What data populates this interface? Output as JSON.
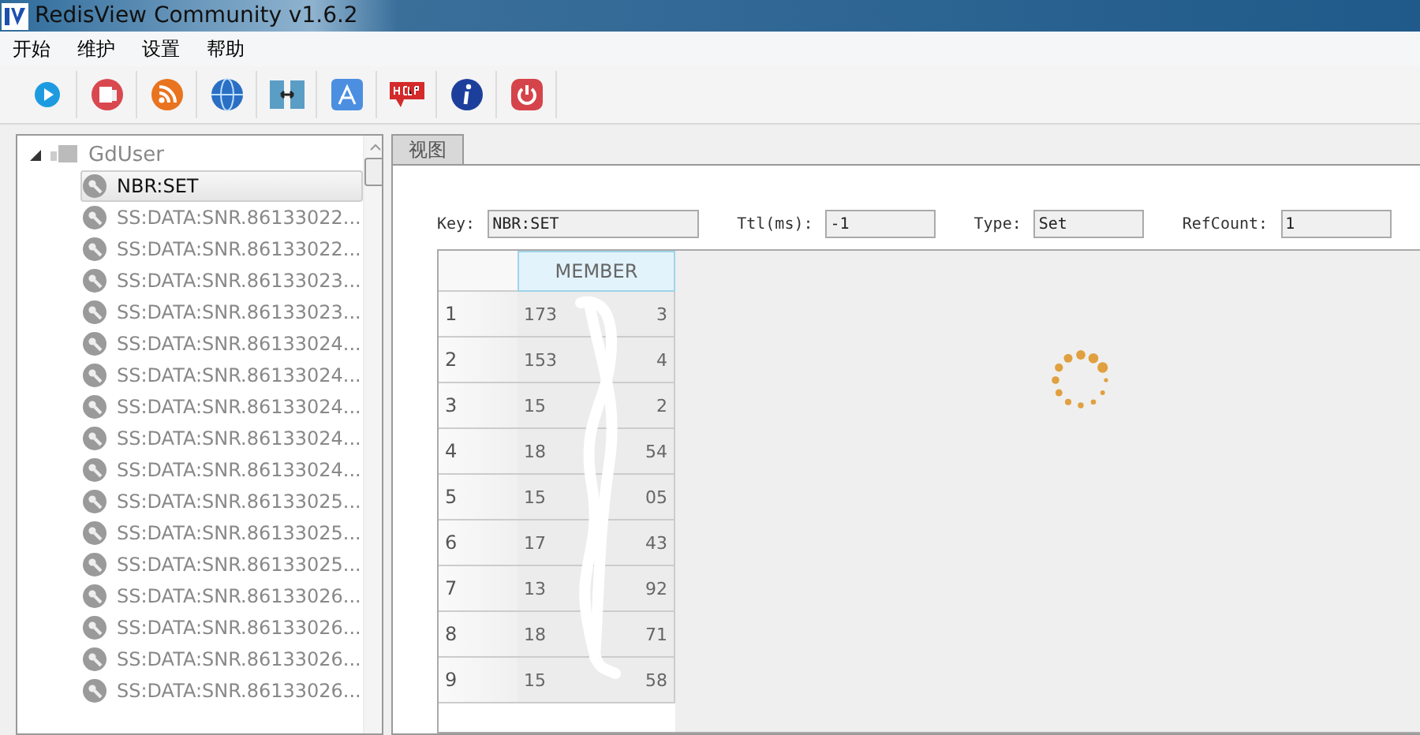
{
  "window": {
    "title": "RedisView Community v1.6.2"
  },
  "menu": [
    "开始",
    "维护",
    "设置",
    "帮助"
  ],
  "toolbar": [
    {
      "kind": "play"
    },
    {
      "kind": "notes"
    },
    {
      "kind": "rss"
    },
    {
      "kind": "globe"
    },
    {
      "kind": "servers"
    },
    {
      "kind": "appstore"
    },
    {
      "kind": "help"
    },
    {
      "kind": "info"
    },
    {
      "kind": "power"
    }
  ],
  "tree": {
    "label": "GdUser",
    "expanded": true,
    "children": [
      {
        "label": "NBR:SET",
        "selected": true
      },
      {
        "label": "SS:DATA:SNR.86133022...",
        "selected": false
      },
      {
        "label": "SS:DATA:SNR.86133022...",
        "selected": false
      },
      {
        "label": "SS:DATA:SNR.86133023...",
        "selected": false
      },
      {
        "label": "SS:DATA:SNR.86133023...",
        "selected": false
      },
      {
        "label": "SS:DATA:SNR.86133024...",
        "selected": false
      },
      {
        "label": "SS:DATA:SNR.86133024...",
        "selected": false
      },
      {
        "label": "SS:DATA:SNR.86133024...",
        "selected": false
      },
      {
        "label": "SS:DATA:SNR.86133024...",
        "selected": false
      },
      {
        "label": "SS:DATA:SNR.86133024...",
        "selected": false
      },
      {
        "label": "SS:DATA:SNR.86133025...",
        "selected": false
      },
      {
        "label": "SS:DATA:SNR.86133025...",
        "selected": false
      },
      {
        "label": "SS:DATA:SNR.86133025...",
        "selected": false
      },
      {
        "label": "SS:DATA:SNR.86133026...",
        "selected": false
      },
      {
        "label": "SS:DATA:SNR.86133026...",
        "selected": false
      },
      {
        "label": "SS:DATA:SNR.86133026...",
        "selected": false
      },
      {
        "label": "SS:DATA:SNR.86133026...",
        "selected": false
      }
    ]
  },
  "tabs": [
    {
      "label": "视图",
      "selected": true
    }
  ],
  "fields": [
    {
      "label": "Key:",
      "value": "NBR:SET"
    },
    {
      "label": "Ttl(ms):",
      "value": "-1"
    },
    {
      "label": "Type:",
      "value": "Set"
    },
    {
      "label": "RefCount:",
      "value": "1"
    }
  ],
  "table": {
    "columns": [
      "MEMBER"
    ],
    "rows": [
      {
        "index": "1",
        "start": "173",
        "end": "3"
      },
      {
        "index": "2",
        "start": "153",
        "end": "4"
      },
      {
        "index": "3",
        "start": "15",
        "end": "2"
      },
      {
        "index": "4",
        "start": "18",
        "end": "54"
      },
      {
        "index": "5",
        "start": "15",
        "end": "05"
      },
      {
        "index": "6",
        "start": "17",
        "end": "43"
      },
      {
        "index": "7",
        "start": "13",
        "end": "92"
      },
      {
        "index": "8",
        "start": "18",
        "end": "71"
      },
      {
        "index": "9",
        "start": "15",
        "end": "58"
      }
    ]
  },
  "loading": true
}
